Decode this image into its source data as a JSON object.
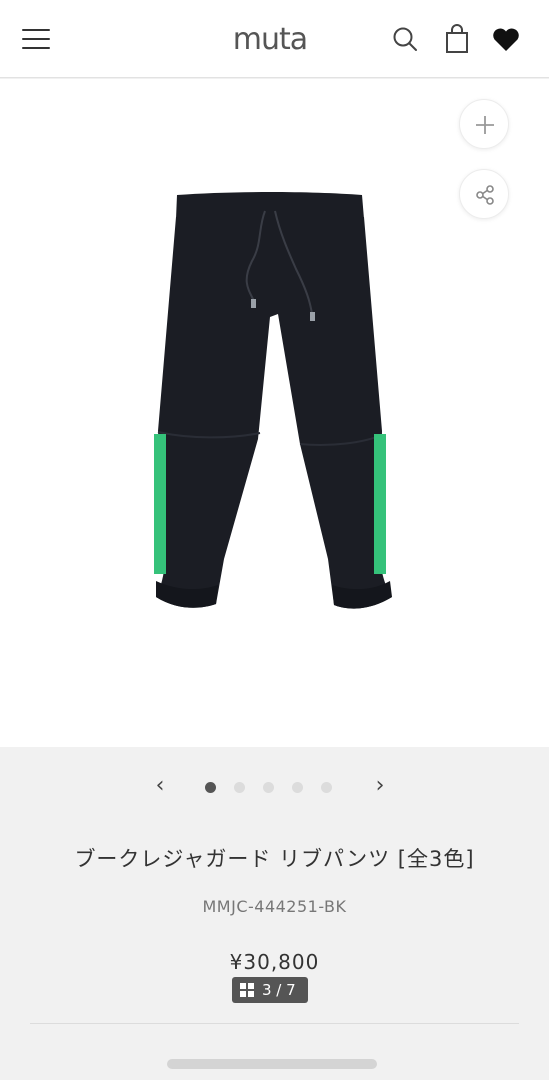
{
  "header": {
    "logo": "muta",
    "icons": [
      "menu-icon",
      "search-icon",
      "bag-icon",
      "heart-icon"
    ]
  },
  "product": {
    "image_alt": "black rib pants with green side stripes",
    "title": "ブークレジャガード リブパンツ [全3色]",
    "sku": "MMJC-444251-BK",
    "price": "¥30,800",
    "image_counter": "3 / 7"
  },
  "carousel": {
    "prev": "‹",
    "next": "›",
    "dots": 5,
    "active_dot": 1
  },
  "colors": {
    "accent_stripe": "#35c27a",
    "pants": "#1b1d24",
    "counter_bg": "#555555"
  }
}
